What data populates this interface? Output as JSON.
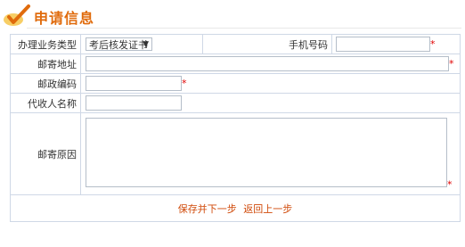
{
  "section": {
    "title": "申请信息",
    "icon": "check-icon"
  },
  "form": {
    "business_type": {
      "label": "办理业务类型",
      "selected": "考后核发证书"
    },
    "phone": {
      "label": "手机号码",
      "value": ""
    },
    "mail_address": {
      "label": "邮寄地址",
      "value": ""
    },
    "postal_code": {
      "label": "邮政编码",
      "value": ""
    },
    "agent_name": {
      "label": "代收人名称",
      "value": ""
    },
    "mail_reason": {
      "label": "邮寄原因",
      "value": ""
    },
    "required_mark": "*"
  },
  "actions": {
    "save_next": "保存并下一步",
    "back": "返回上一步"
  },
  "colors": {
    "title": "#e06b0c",
    "required": "#e00000",
    "link": "#d04a0a",
    "border": "#cfd8e6"
  }
}
